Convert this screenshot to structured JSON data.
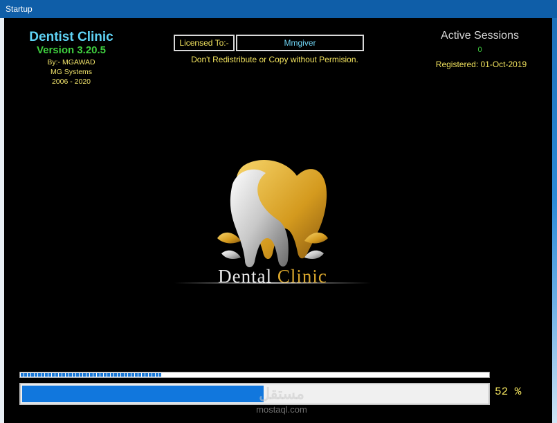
{
  "window": {
    "title": "Startup"
  },
  "header": {
    "app_title": "Dentist Clinic",
    "version": "Version 3.20.5",
    "author": "By:- MGAWAD",
    "company": "MG Systems",
    "years": "2006 - 2020"
  },
  "license": {
    "label": "Licensed To:-",
    "value": "Mmgiver",
    "notice": "Don't Redistribute or Copy without Permision."
  },
  "sessions": {
    "label": "Active Sessions",
    "count": "0",
    "registered": "Registered: 01-Oct-2019"
  },
  "logo": {
    "word1": "Dental",
    "word2": "Clinic"
  },
  "progress": {
    "secondary_fraction": 0.3,
    "main_fraction": 0.52,
    "percent_text": "52 %"
  },
  "watermark": {
    "arabic": "مستقل",
    "latin": "mostaql.com"
  },
  "colors": {
    "title_cyan": "#5fd3f5",
    "version_green": "#3fcf3f",
    "text_yellow": "#f2e35e",
    "progress_blue": "#1177dd",
    "logo_gold": "#d9a62c"
  }
}
